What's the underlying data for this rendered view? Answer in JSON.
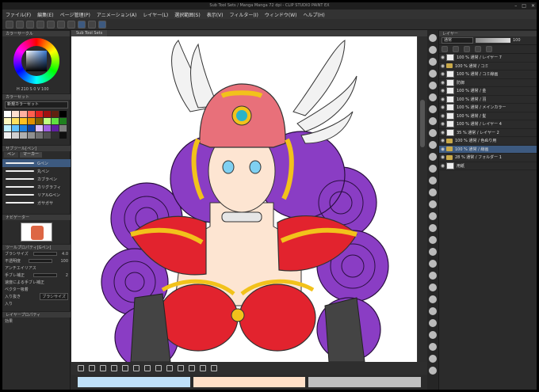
{
  "window": {
    "title": "Sub Tool Sets / Manga Manga 72 dpi - CLIP STUDIO PAINT EX",
    "buttons": [
      "–",
      "□",
      "✕"
    ]
  },
  "menu": {
    "items": [
      "ファイル(F)",
      "編集(E)",
      "ページ管理(P)",
      "アニメーション(A)",
      "レイヤー(L)",
      "選択範囲(S)",
      "表示(V)",
      "フィルター(I)",
      "ウィンドウ(W)",
      "ヘルプ(H)"
    ]
  },
  "canvas": {
    "tab_label": "Sub Tool Sets"
  },
  "left_panel": {
    "color_wheel_header": "カラーサークル",
    "color_readout": "H 210  S 0  V 100",
    "palette_header": "カラーセット",
    "palette_name": "新規カラーセット",
    "palette_colors": [
      "#ffffff",
      "#ffe0d0",
      "#ffb0a0",
      "#ff6050",
      "#e02020",
      "#a01010",
      "#602010",
      "#000000",
      "#fff8c0",
      "#ffe060",
      "#ffc020",
      "#e09000",
      "#806000",
      "#c0ff80",
      "#60e040",
      "#208020",
      "#c0f0ff",
      "#60c0ff",
      "#2080e0",
      "#1040a0",
      "#e0c0ff",
      "#a060e0",
      "#6020a0",
      "#808080",
      "#f0f0f0",
      "#d0d0d0",
      "#b0b0b0",
      "#909090",
      "#707070",
      "#505050",
      "#303030",
      "#101010"
    ],
    "subtool_header": "サブツール[ペン]",
    "subtool_tabs": [
      "ペン",
      "マーカー"
    ],
    "brushes": [
      {
        "name": "Gペン",
        "selected": true
      },
      {
        "name": "丸ペン",
        "selected": false
      },
      {
        "name": "カブラペン",
        "selected": false
      },
      {
        "name": "カリグラフィ",
        "selected": false
      },
      {
        "name": "リアルGペン",
        "selected": false
      },
      {
        "name": "ガサガサ",
        "selected": false
      }
    ],
    "navigator_header": "ナビゲーター",
    "tool_prop_header": "ツールプロパティ[Gペン]",
    "props": [
      {
        "label": "ブラシサイズ",
        "value": "4.0"
      },
      {
        "label": "不透明度",
        "value": "100"
      },
      {
        "label": "アンチエイリアス",
        "value": ""
      },
      {
        "label": "手ブレ補正",
        "value": "2"
      },
      {
        "label": "速度による手ブレ補正",
        "value": ""
      },
      {
        "label": "ベクター吸着",
        "value": ""
      },
      {
        "label": "入り抜き",
        "value": "ブラシサイズ"
      },
      {
        "label": "入り",
        "value": ""
      }
    ],
    "layer_prop_header": "レイヤープロパティ",
    "layer_prop_label": "効果"
  },
  "right_panel": {
    "header": "レイヤー",
    "blend_mode": "通常",
    "opacity": "100",
    "layers": [
      {
        "name": "100 % 通常 / レイヤー 7",
        "kind": "layer",
        "selected": false
      },
      {
        "name": "100 % 通常 / コミ",
        "kind": "folder",
        "selected": false
      },
      {
        "name": "100 % 通常 / コミ線画",
        "kind": "layer",
        "selected": false
      },
      {
        "name": "防御",
        "kind": "layer",
        "selected": false
      },
      {
        "name": "100 % 通常 / 金",
        "kind": "layer",
        "selected": false
      },
      {
        "name": "100 % 通常 / 羽",
        "kind": "layer",
        "selected": false
      },
      {
        "name": "100 % 通常 / メインカラー",
        "kind": "layer",
        "selected": false
      },
      {
        "name": "100 % 通常 / 髪",
        "kind": "layer",
        "selected": false
      },
      {
        "name": "100 % 通常 / レイヤー 4",
        "kind": "layer",
        "selected": false
      },
      {
        "name": "35 % 通常 / レイヤー 2",
        "kind": "layer",
        "selected": false
      },
      {
        "name": "100 % 通常 / 色ぬり用",
        "kind": "folder",
        "selected": false
      },
      {
        "name": "100 % 通常 / 線画",
        "kind": "folder",
        "selected": true
      },
      {
        "name": "28 % 通常 / フォルダー 1",
        "kind": "folder",
        "selected": false
      },
      {
        "name": "用紙",
        "kind": "layer",
        "selected": false
      }
    ]
  },
  "bottom": {
    "color_bars": [
      "#bfe0f8",
      "#ffe0c8",
      "#c0c0c0"
    ]
  }
}
